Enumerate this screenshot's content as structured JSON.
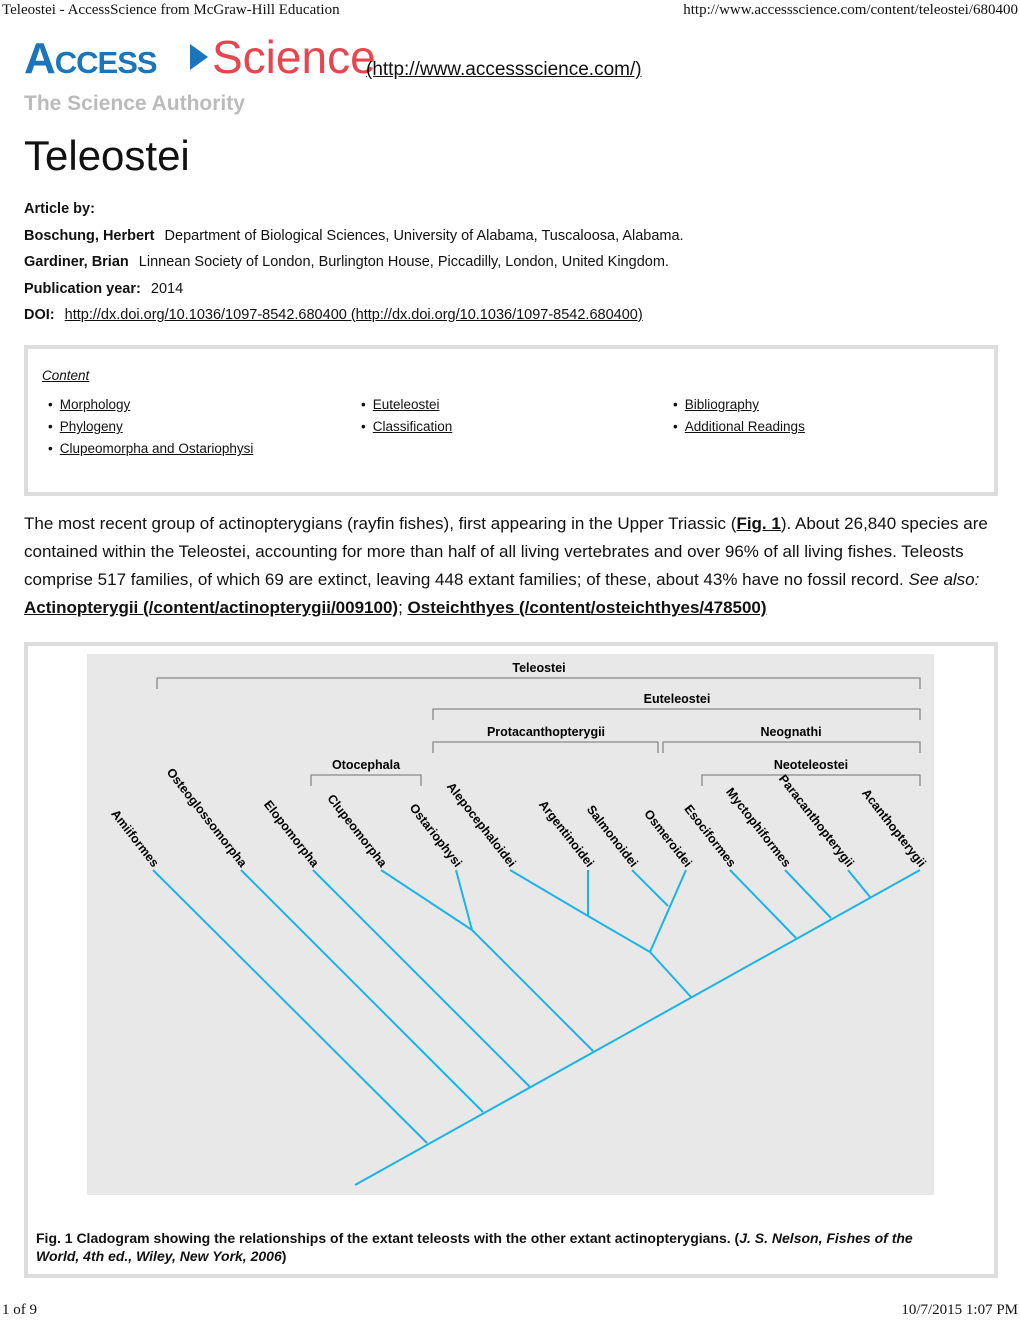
{
  "browser_header": {
    "title": "Teleostei - AccessScience from McGraw-Hill Education",
    "url": "http://www.accessscience.com/content/teleostei/680400"
  },
  "logo": {
    "access": "Access",
    "science": "Science",
    "tagline": "The Science Authority",
    "link": "(http://www.accessscience.com/)"
  },
  "title": "Teleostei",
  "article": {
    "label": "Article by:",
    "authors": [
      {
        "name": "Boschung, Herbert",
        "affiliation": "Department of Biological Sciences, University of Alabama, Tuscaloosa, Alabama."
      },
      {
        "name": "Gardiner, Brian",
        "affiliation": "Linnean Society of London, Burlington House, Piccadilly, London, United Kingdom."
      }
    ],
    "pub_label": "Publication year:",
    "pub_year": "2014",
    "doi_label": "DOI:",
    "doi": "http://dx.doi.org/10.1036/1097-8542.680400 (http://dx.doi.org/10.1036/1097-8542.680400)"
  },
  "toc": {
    "heading": "Content ",
    "col1": [
      "Morphology",
      "Phylogeny",
      "Clupeomorpha and Ostariophysi"
    ],
    "col2": [
      "Euteleostei",
      "Classification"
    ],
    "col3": [
      "Bibliography",
      "Additional Readings"
    ]
  },
  "body": {
    "p1": "The most recent group of actinopterygians (rayfin fishes), first appearing in the Upper Triassic (",
    "fig_link": "Fig. 1",
    "p2": "). About 26,840 species are contained within the Teleostei, accounting for more than half of all living vertebrates and over 96% of all living fishes. Teleosts comprise 517 families, of which 69 are extinct, leaving 448 extant families; of these, about 43% have no fossil record. ",
    "see_also": "See also:",
    "link1": "Actinopterygii (/content/actinopterygii/009100)",
    "sep": "; ",
    "link2": "Osteichthyes (/content/osteichthyes/478500)"
  },
  "figure": {
    "clades": [
      "Teleostei",
      "Euteleostei",
      "Protacanthopterygii",
      "Neognathi",
      "Otocephala",
      "Neoteleostei"
    ],
    "taxa": [
      "Amiiformes",
      "Osteoglossomorpha",
      "Elopomorpha",
      "Clupeomorpha",
      "Ostariophysi",
      "Alepocephaloidei",
      "Argentinoidei",
      "Salmonoidei",
      "Osmeroidei",
      "Esociformes",
      "Myctophiformes",
      "Paracanthopterygii",
      "Acanthopterygii"
    ],
    "line_color": "#1ab4e8",
    "bg_color": "#e8e8e8",
    "caption": "Fig. 1 Cladogram showing the relationships of the extant teleosts with the other extant actinopterygians. (",
    "caption_cite": "J. S. Nelson, Fishes of the World, 4th ed., Wiley, New York, 2006",
    "caption_end": ")"
  },
  "footer": {
    "page": "1 of 9",
    "datetime": "10/7/2015 1:07 PM"
  }
}
